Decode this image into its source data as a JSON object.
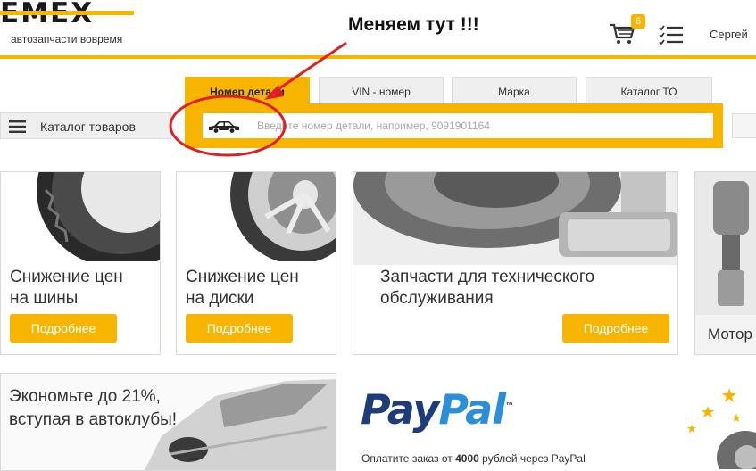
{
  "header": {
    "logo_text": "EMEX",
    "tagline": "автозапчасти вовремя",
    "cart_count": "6",
    "user_name": "Сергей"
  },
  "annotation": {
    "text": "Меняем тут !!!"
  },
  "search": {
    "tabs": [
      {
        "label": "Номер детали"
      },
      {
        "label": "VIN - номер"
      },
      {
        "label": "Марка"
      },
      {
        "label": "Каталог ТО"
      }
    ],
    "active_tab": "Номер детали",
    "catalog_button": "Каталог товаров",
    "placeholder": "Введите номер детали, например, 9091901164"
  },
  "promos": [
    {
      "title_line1": "Снижение цен",
      "title_line2": "на шины",
      "button": "Подробнее"
    },
    {
      "title_line1": "Снижение цен",
      "title_line2": "на диски",
      "button": "Подробнее"
    },
    {
      "title_line1": "Запчасти для технического",
      "title_line2": "обслуживания",
      "button": "Подробнее"
    },
    {
      "title_line1": "Мотор",
      "title_line2": "",
      "button": ""
    }
  ],
  "autoclub": {
    "line1": "Экономьте до 21%,",
    "line2": "вступая в автоклубы!"
  },
  "paypal": {
    "logo_pay": "Pay",
    "logo_pal": "Pal",
    "trademark": "™",
    "text_before": "Оплатите заказ от ",
    "text_amount": "4000",
    "text_after": " рублей через PayPal"
  },
  "colors": {
    "accent": "#f7b500",
    "annotation_red": "#e02020",
    "paypal_dark": "#1e3c7a",
    "paypal_light": "#2a8ed8"
  }
}
